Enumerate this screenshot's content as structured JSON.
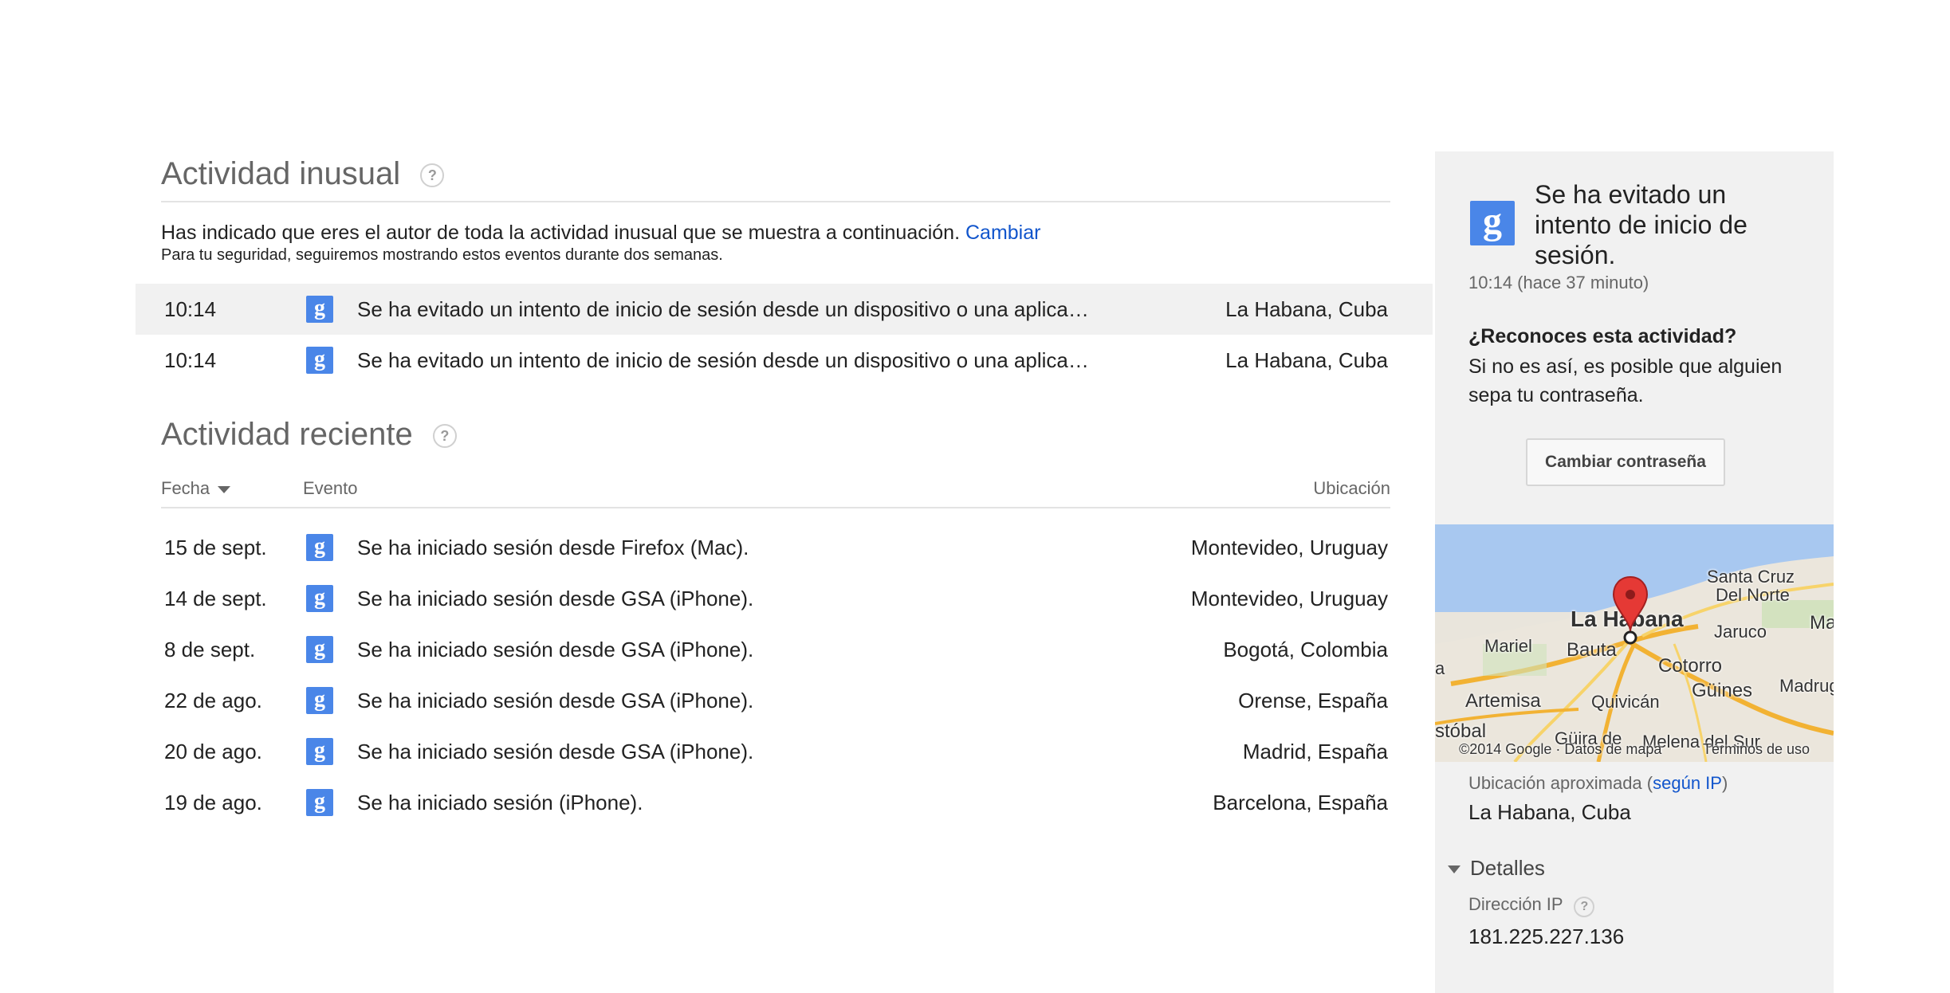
{
  "unusual": {
    "title": "Actividad inusual",
    "help": "?",
    "notice": "Has indicado que eres el autor de toda la actividad inusual que se muestra a continuación.",
    "change_link": "Cambiar",
    "notice_sub": "Para tu seguridad, seguiremos mostrando estos eventos durante dos semanas.",
    "rows": [
      {
        "date": "10:14",
        "icon": "google-g-icon",
        "event": "Se ha evitado un intento de inicio de sesión desde un dispositivo o una aplicación",
        "location": "La Habana, Cuba"
      },
      {
        "date": "10:14",
        "icon": "google-g-icon",
        "event": "Se ha evitado un intento de inicio de sesión desde un dispositivo o una aplicación",
        "location": "La Habana, Cuba"
      }
    ]
  },
  "recent": {
    "title": "Actividad reciente",
    "help": "?",
    "columns": {
      "date": "Fecha",
      "event": "Evento",
      "location": "Ubicación"
    },
    "rows": [
      {
        "date": "15 de sept.",
        "event": "Se ha iniciado sesión desde Firefox (Mac).",
        "location": "Montevideo, Uruguay"
      },
      {
        "date": "14 de sept.",
        "event": "Se ha iniciado sesión desde GSA (iPhone).",
        "location": "Montevideo, Uruguay"
      },
      {
        "date": "8 de sept.",
        "event": "Se ha iniciado sesión desde GSA (iPhone).",
        "location": "Bogotá, Colombia"
      },
      {
        "date": "22 de ago.",
        "event": "Se ha iniciado sesión desde GSA (iPhone).",
        "location": "Orense, España"
      },
      {
        "date": "20 de ago.",
        "event": "Se ha iniciado sesión desde GSA (iPhone).",
        "location": "Madrid, España"
      },
      {
        "date": "19 de ago.",
        "event": "Se ha iniciado sesión (iPhone).",
        "location": "Barcelona, España"
      }
    ]
  },
  "panel": {
    "title": "Se ha evitado un intento de inicio de sesión.",
    "time": "10:14 (hace 37 minuto)",
    "question": "¿Reconoces esta actividad?",
    "warning": "Si no es así, es posible que alguien sepa tu contraseña.",
    "button": "Cambiar contraseña",
    "map": {
      "labels": [
        "Santa Cruz",
        "Del Norte",
        "La Habana",
        "Jaruco",
        "Mariel",
        "Bauta",
        "Cotorro",
        "Artemisa",
        "Quivicán",
        "Güines",
        "Madrug",
        "stóbal",
        "Güira de",
        "Melena del Sur",
        "Ma",
        "a"
      ],
      "copyright": "©2014 Google · Datos de mapa",
      "terms": "Términos de uso"
    },
    "approx_label": "Ubicación aproximada (",
    "approx_link": "según IP",
    "approx_close": ")",
    "approx_value": "La Habana, Cuba",
    "details": "Detalles",
    "ip_label": "Dirección IP",
    "ip_help": "?",
    "ip_value": "181.225.227.136"
  }
}
